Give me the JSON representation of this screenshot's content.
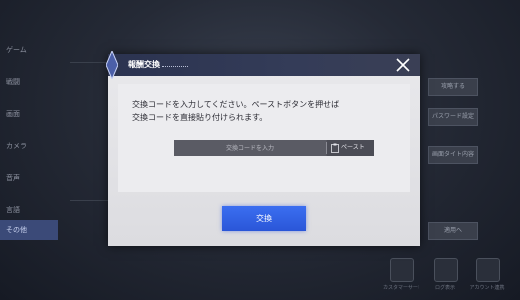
{
  "background": {
    "sidebar": {
      "items": [
        {
          "label": "ゲーム",
          "active": false
        },
        {
          "label": "戦闘",
          "active": false
        },
        {
          "label": "画面",
          "active": false
        },
        {
          "label": "カメラ",
          "active": false
        },
        {
          "label": "音声",
          "active": false
        },
        {
          "label": "言語",
          "active": false
        },
        {
          "label": "その他",
          "active": true
        }
      ]
    },
    "right_buttons": [
      "攻略する",
      "パスワード設定",
      "画面タイト内容",
      "適用へ"
    ],
    "bottom_bar": [
      "カスタマーサービス",
      "ログ表示",
      "アカウント連携"
    ]
  },
  "modal": {
    "title": "報酬交換",
    "message_lines": [
      "交換コードを入力してください。ペーストボタンを押せば",
      "交換コードを直接貼り付けられます。"
    ],
    "input": {
      "placeholder": "交換コードを入力",
      "value": ""
    },
    "paste_label": "ペースト",
    "confirm_label": "交換"
  },
  "colors": {
    "header": "#2b3350",
    "accent": "#2a56d8",
    "panel": "#e9e9ec"
  }
}
